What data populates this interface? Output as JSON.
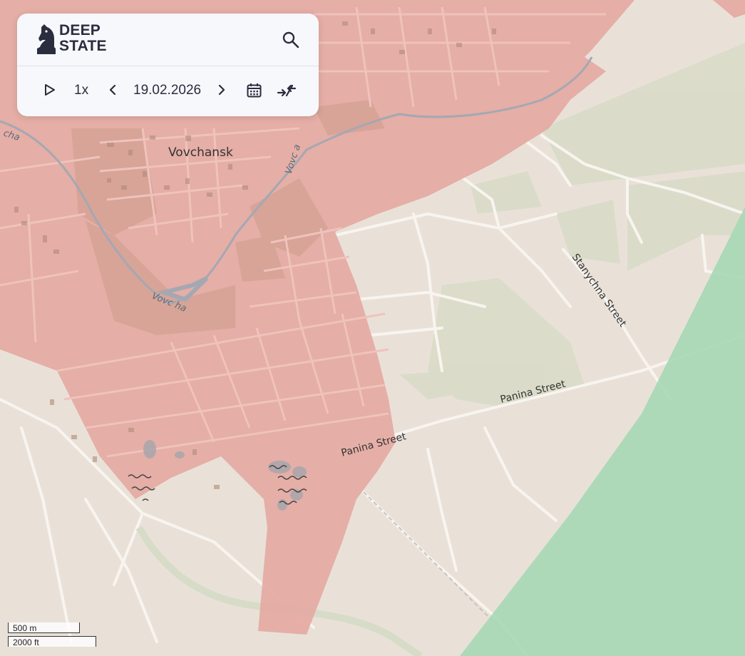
{
  "brand": {
    "line1": "DEEP",
    "line2": "STATE"
  },
  "player": {
    "speed": "1x",
    "date": "19.02.2026"
  },
  "map_labels": {
    "town": "Vovchansk",
    "river_1": "Vovc ha",
    "river_2": "Vovc a",
    "river_3": "cha",
    "street_1": "Stanychna Street",
    "street_2": "Panina Street",
    "street_3": "Panina Street"
  },
  "scale": {
    "metric": "500 m",
    "imperial": "2000 ft"
  },
  "colors": {
    "base": "#e9e1d8",
    "occupied": "#e4a9a2",
    "liberated": "#a9d7b6",
    "park": "#d8dcc8",
    "road": "#f7f3ee",
    "water": "#a4a8b3"
  },
  "icons": [
    "knight-logo-icon",
    "search-icon",
    "play-icon",
    "chevron-left-icon",
    "chevron-right-icon",
    "calendar-icon",
    "collapse-arrows-icon"
  ]
}
